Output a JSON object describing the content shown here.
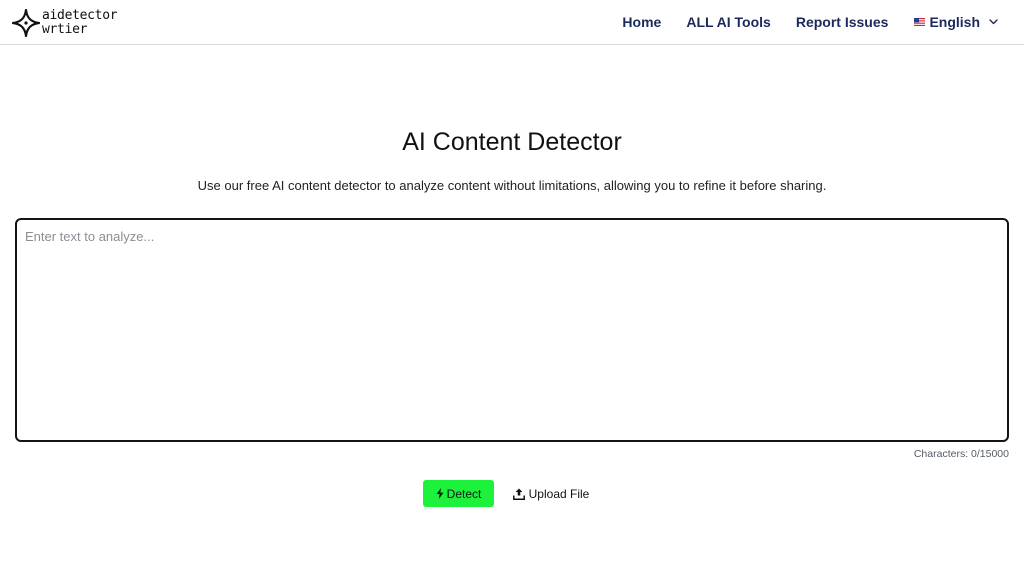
{
  "header": {
    "logo": {
      "line1": "aidetector",
      "line2": "wrtier",
      "icon": "sparkle-star-icon"
    },
    "nav": [
      {
        "label": "Home"
      },
      {
        "label": "ALL AI Tools"
      },
      {
        "label": "Report Issues"
      }
    ],
    "language": {
      "label": "English",
      "flag_icon": "us-flag-icon",
      "caret_icon": "chevron-down-icon"
    }
  },
  "main": {
    "title": "AI Content Detector",
    "subtitle": "Use our free AI content detector to analyze content without limitations, allowing you to refine it before sharing.",
    "editor": {
      "placeholder": "Enter text to analyze...",
      "value": ""
    },
    "char_count": "Characters: 0/15000",
    "detect_label": "Detect",
    "detect_icon": "lightning-bolt-icon",
    "upload_label": "Upload File",
    "upload_icon": "upload-icon"
  },
  "colors": {
    "nav_text": "#1b2a5c",
    "detect_button": "#1cf23b",
    "editor_border": "#141414"
  }
}
